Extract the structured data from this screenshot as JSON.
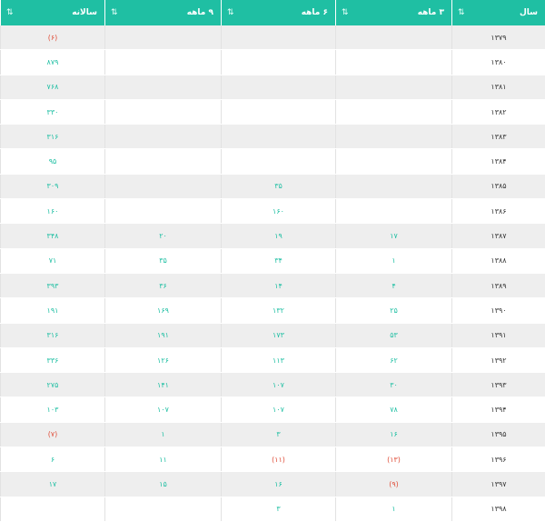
{
  "table": {
    "headers": [
      {
        "label": "سال"
      },
      {
        "label": "۳ ماهه"
      },
      {
        "label": "۶ ماهه"
      },
      {
        "label": "۹ ماهه"
      },
      {
        "label": "سالانه"
      }
    ],
    "sort_icon": "⇅",
    "rows": [
      {
        "year": "۱۳۷۹",
        "m3": "",
        "m6": "",
        "m9": "",
        "annual": "(۶)"
      },
      {
        "year": "۱۳۸۰",
        "m3": "",
        "m6": "",
        "m9": "",
        "annual": "۸۷۹"
      },
      {
        "year": "۱۳۸۱",
        "m3": "",
        "m6": "",
        "m9": "",
        "annual": "۷۶۸"
      },
      {
        "year": "۱۳۸۲",
        "m3": "",
        "m6": "",
        "m9": "",
        "annual": "۳۳۰"
      },
      {
        "year": "۱۳۸۳",
        "m3": "",
        "m6": "",
        "m9": "",
        "annual": "۳۱۶"
      },
      {
        "year": "۱۳۸۴",
        "m3": "",
        "m6": "",
        "m9": "",
        "annual": "۹۵"
      },
      {
        "year": "۱۳۸۵",
        "m3": "",
        "m6": "۳۵",
        "m9": "",
        "annual": "۳۰۹"
      },
      {
        "year": "۱۳۸۶",
        "m3": "",
        "m6": "۱۶۰",
        "m9": "",
        "annual": "۱۶۰"
      },
      {
        "year": "۱۳۸۷",
        "m3": "۱۷",
        "m6": "۱۹",
        "m9": "۲۰",
        "annual": "۳۴۸"
      },
      {
        "year": "۱۳۸۸",
        "m3": "۱",
        "m6": "۳۴",
        "m9": "۳۵",
        "annual": "۷۱"
      },
      {
        "year": "۱۳۸۹",
        "m3": "۴",
        "m6": "۱۴",
        "m9": "۳۶",
        "annual": "۳۹۳"
      },
      {
        "year": "۱۳۹۰",
        "m3": "۲۵",
        "m6": "۱۳۲",
        "m9": "۱۶۹",
        "annual": "۱۹۱"
      },
      {
        "year": "۱۳۹۱",
        "m3": "۵۳",
        "m6": "۱۷۳",
        "m9": "۱۹۱",
        "annual": "۳۱۶"
      },
      {
        "year": "۱۳۹۲",
        "m3": "۶۲",
        "m6": "۱۱۳",
        "m9": "۱۲۶",
        "annual": "۳۳۶"
      },
      {
        "year": "۱۳۹۳",
        "m3": "۳۰",
        "m6": "۱۰۷",
        "m9": "۱۴۱",
        "annual": "۲۷۵"
      },
      {
        "year": "۱۳۹۴",
        "m3": "۷۸",
        "m6": "۱۰۷",
        "m9": "۱۰۷",
        "annual": "۱۰۳"
      },
      {
        "year": "۱۳۹۵",
        "m3": "۱۶",
        "m6": "۳",
        "m9": "۱",
        "annual": "(۷)"
      },
      {
        "year": "۱۳۹۶",
        "m3": "(۱۳)",
        "m6": "(۱۱)",
        "m9": "۱۱",
        "annual": "۶"
      },
      {
        "year": "۱۳۹۷",
        "m3": "(۹)",
        "m6": "۱۶",
        "m9": "۱۵",
        "annual": "۱۷"
      },
      {
        "year": "۱۳۹۸",
        "m3": "۱",
        "m6": "۳",
        "m9": "",
        "annual": ""
      }
    ]
  },
  "colors": {
    "header_bg": "#1fbfa3",
    "header_text": "#ffffff",
    "value_text": "#1fbfa3",
    "negative_text": "#e0503c",
    "stripe_bg": "#eeeeee"
  }
}
